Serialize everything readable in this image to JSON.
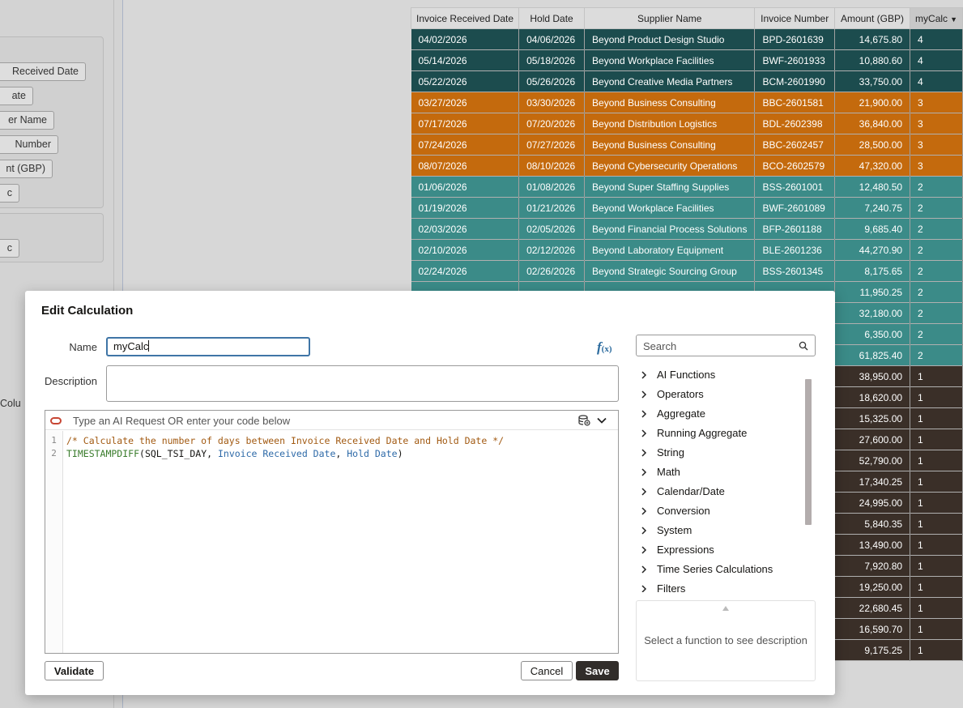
{
  "colors": {
    "dark_teal": "#1c4c4e",
    "orange": "#c46a0d",
    "teal": "#3b8b88",
    "dark_brown": "#3a2f28",
    "save_bg": "#312d2a",
    "accent_blue": "#3f75a6"
  },
  "background": {
    "pills": [
      "Received Date",
      "ate",
      "er Name",
      "Number",
      "nt (GBP)",
      "c",
      "c"
    ],
    "colu_label": "Colu"
  },
  "table": {
    "headers": [
      "Invoice Received Date",
      "Hold Date",
      "Supplier Name",
      "Invoice Number",
      "Amount (GBP)",
      "myCalc"
    ],
    "rows": [
      {
        "group": "dark_teal",
        "cells": [
          "04/02/2026",
          "04/06/2026",
          "Beyond Product Design Studio",
          "BPD-2601639",
          "14,675.80",
          "4"
        ]
      },
      {
        "group": "dark_teal",
        "cells": [
          "05/14/2026",
          "05/18/2026",
          "Beyond Workplace Facilities",
          "BWF-2601933",
          "10,880.60",
          "4"
        ]
      },
      {
        "group": "dark_teal",
        "cells": [
          "05/22/2026",
          "05/26/2026",
          "Beyond Creative Media Partners",
          "BCM-2601990",
          "33,750.00",
          "4"
        ]
      },
      {
        "group": "orange",
        "cells": [
          "03/27/2026",
          "03/30/2026",
          "Beyond Business Consulting",
          "BBC-2601581",
          "21,900.00",
          "3"
        ]
      },
      {
        "group": "orange",
        "cells": [
          "07/17/2026",
          "07/20/2026",
          "Beyond Distribution Logistics",
          "BDL-2602398",
          "36,840.00",
          "3"
        ]
      },
      {
        "group": "orange",
        "cells": [
          "07/24/2026",
          "07/27/2026",
          "Beyond Business Consulting",
          "BBC-2602457",
          "28,500.00",
          "3"
        ]
      },
      {
        "group": "orange",
        "cells": [
          "08/07/2026",
          "08/10/2026",
          "Beyond Cybersecurity Operations",
          "BCO-2602579",
          "47,320.00",
          "3"
        ]
      },
      {
        "group": "teal",
        "cells": [
          "01/06/2026",
          "01/08/2026",
          "Beyond Super Staffing Supplies",
          "BSS-2601001",
          "12,480.50",
          "2"
        ]
      },
      {
        "group": "teal",
        "cells": [
          "01/19/2026",
          "01/21/2026",
          "Beyond Workplace Facilities",
          "BWF-2601089",
          "7,240.75",
          "2"
        ]
      },
      {
        "group": "teal",
        "cells": [
          "02/03/2026",
          "02/05/2026",
          "Beyond Financial Process Solutions",
          "BFP-2601188",
          "9,685.40",
          "2"
        ]
      },
      {
        "group": "teal",
        "cells": [
          "02/10/2026",
          "02/12/2026",
          "Beyond Laboratory Equipment",
          "BLE-2601236",
          "44,270.90",
          "2"
        ]
      },
      {
        "group": "teal",
        "cells": [
          "02/24/2026",
          "02/26/2026",
          "Beyond Strategic Sourcing Group",
          "BSS-2601345",
          "8,175.65",
          "2"
        ]
      },
      {
        "group": "teal",
        "cells": [
          "",
          "",
          "",
          "",
          "11,950.25",
          "2"
        ]
      },
      {
        "group": "teal",
        "cells": [
          "",
          "",
          "",
          "",
          "32,180.00",
          "2"
        ]
      },
      {
        "group": "teal",
        "cells": [
          "",
          "",
          "",
          "",
          "6,350.00",
          "2"
        ]
      },
      {
        "group": "teal",
        "cells": [
          "",
          "",
          "",
          "",
          "61,825.40",
          "2"
        ]
      },
      {
        "group": "dark_brown",
        "cells": [
          "",
          "",
          "",
          "",
          "38,950.00",
          "1"
        ]
      },
      {
        "group": "dark_brown",
        "cells": [
          "",
          "",
          "",
          "",
          "18,620.00",
          "1"
        ]
      },
      {
        "group": "dark_brown",
        "cells": [
          "",
          "",
          "",
          "",
          "15,325.00",
          "1"
        ]
      },
      {
        "group": "dark_brown",
        "cells": [
          "",
          "",
          "",
          "",
          "27,600.00",
          "1"
        ]
      },
      {
        "group": "dark_brown",
        "cells": [
          "",
          "",
          "",
          "",
          "52,790.00",
          "1"
        ]
      },
      {
        "group": "dark_brown",
        "cells": [
          "",
          "",
          "",
          "",
          "17,340.25",
          "1"
        ]
      },
      {
        "group": "dark_brown",
        "cells": [
          "",
          "",
          "",
          "",
          "24,995.00",
          "1"
        ]
      },
      {
        "group": "dark_brown",
        "cells": [
          "",
          "",
          "",
          "",
          "5,840.35",
          "1"
        ]
      },
      {
        "group": "dark_brown",
        "cells": [
          "",
          "",
          "",
          "",
          "13,490.00",
          "1"
        ]
      },
      {
        "group": "dark_brown",
        "cells": [
          "",
          "",
          "",
          "",
          "7,920.80",
          "1"
        ]
      },
      {
        "group": "dark_brown",
        "cells": [
          "",
          "",
          "",
          "",
          "19,250.00",
          "1"
        ]
      },
      {
        "group": "dark_brown",
        "cells": [
          "",
          "",
          "",
          "",
          "22,680.45",
          "1"
        ]
      },
      {
        "group": "dark_brown",
        "cells": [
          "",
          "",
          "",
          "",
          "16,590.70",
          "1"
        ]
      },
      {
        "group": "dark_brown",
        "cells": [
          "",
          "",
          "",
          "",
          "9,175.25",
          "1"
        ]
      }
    ]
  },
  "dialog": {
    "title": "Edit Calculation",
    "name_label": "Name",
    "name_value": "myCalc",
    "description_label": "Description",
    "description_value": "",
    "ai_placeholder": "Type an AI Request OR enter your code below",
    "line_numbers": [
      "1",
      "2"
    ],
    "code": {
      "comment": "/* Calculate the number of days between Invoice Received Date and Hold Date */",
      "fn": "TIMESTAMPDIFF",
      "open": "(",
      "arg1": "SQL_TSI_DAY",
      "sep1": ", ",
      "arg2": "Invoice Received Date",
      "sep2": ", ",
      "arg3": "Hold Date",
      "close": ")"
    },
    "validate_label": "Validate",
    "cancel_label": "Cancel",
    "save_label": "Save",
    "search_placeholder": "Search",
    "function_categories": [
      "AI Functions",
      "Operators",
      "Aggregate",
      "Running Aggregate",
      "String",
      "Math",
      "Calendar/Date",
      "Conversion",
      "System",
      "Expressions",
      "Time Series Calculations",
      "Filters"
    ],
    "function_description": "Select a function to see description"
  }
}
